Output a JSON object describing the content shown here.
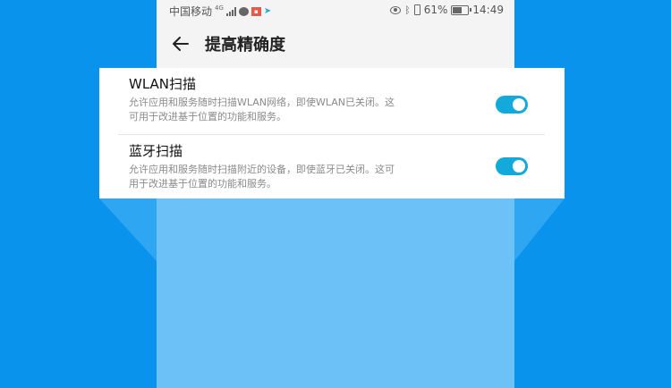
{
  "status_bar": {
    "carrier": "中国移动",
    "network_badge": "4G",
    "battery_percent": "61%",
    "battery_level": 0.61,
    "time": "14:49",
    "icons": [
      "signal-icon",
      "message-icon",
      "app-notification-icon",
      "plane-icon",
      "eye-icon",
      "bluetooth-icon",
      "vibrate-icon",
      "battery-icon"
    ]
  },
  "header": {
    "title": "提高精确度",
    "back_icon": "back-arrow-icon"
  },
  "settings": [
    {
      "title": "WLAN扫描",
      "description": "允许应用和服务随时扫描WLAN网络，即使WLAN已关闭。这可用于改进基于位置的功能和服务。",
      "enabled": true
    },
    {
      "title": "蓝牙扫描",
      "description": "允许应用和服务随时扫描附近的设备，即使蓝牙已关闭。这可用于改进基于位置的功能和服务。",
      "enabled": true
    }
  ],
  "colors": {
    "background_blue": "#0a93ec",
    "toggle_on": "#13a9da",
    "card": "#ffffff"
  }
}
